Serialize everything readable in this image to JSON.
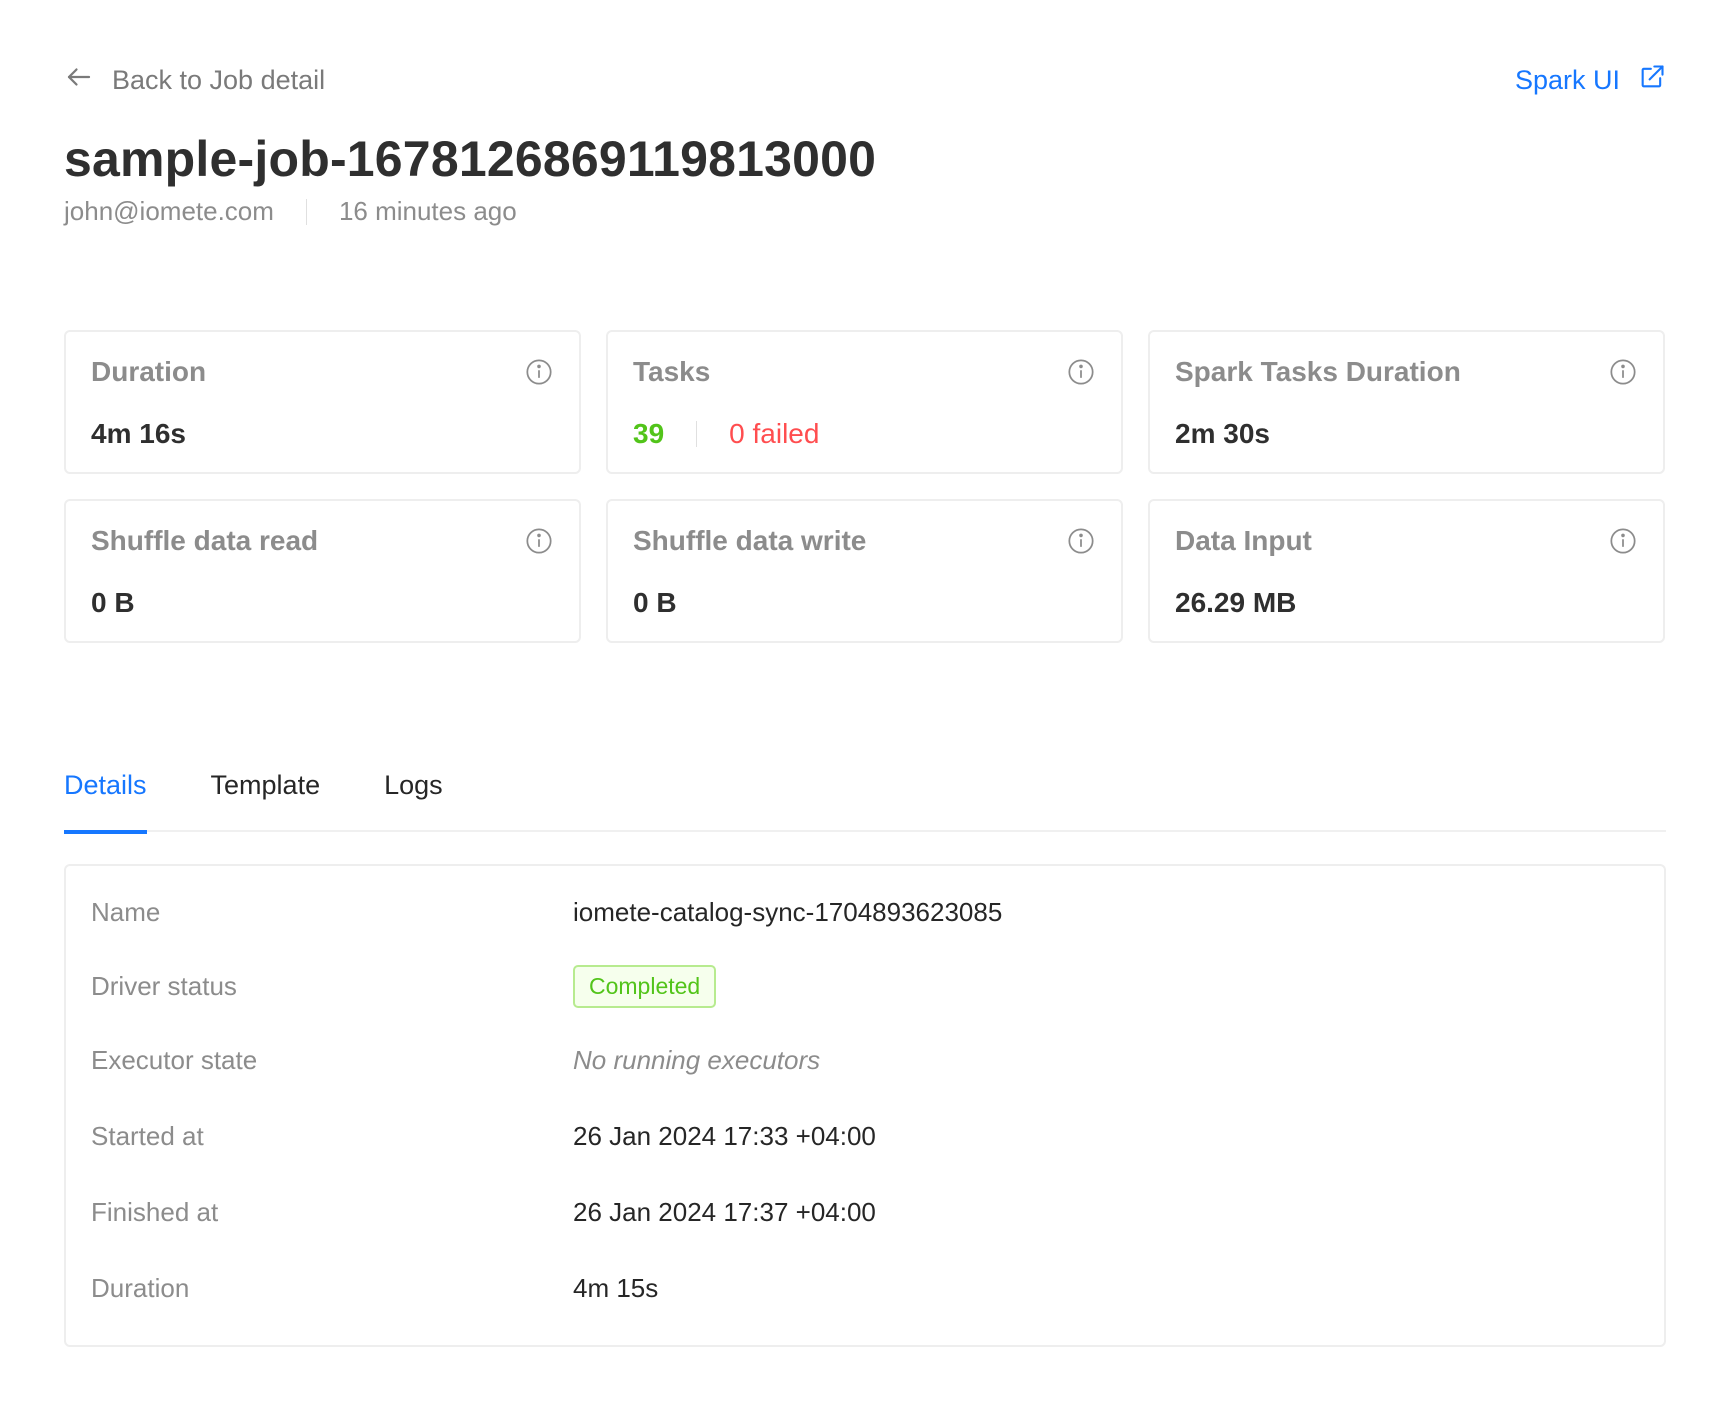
{
  "header": {
    "back_label": "Back to Job detail",
    "spark_ui_label": "Spark UI",
    "title": "sample-job-1678126869119813000",
    "user": "john@iomete.com",
    "time_ago": "16 minutes ago"
  },
  "stats": {
    "duration": {
      "label": "Duration",
      "value": "4m 16s"
    },
    "tasks": {
      "label": "Tasks",
      "count": "39",
      "failed": "0 failed"
    },
    "spark_tasks_duration": {
      "label": "Spark Tasks Duration",
      "value": "2m 30s"
    },
    "shuffle_read": {
      "label": "Shuffle data read",
      "value": "0 B"
    },
    "shuffle_write": {
      "label": "Shuffle data write",
      "value": "0 B"
    },
    "data_input": {
      "label": "Data Input",
      "value": "26.29 MB"
    }
  },
  "tabs": [
    {
      "label": "Details",
      "active": true
    },
    {
      "label": "Template",
      "active": false
    },
    {
      "label": "Logs",
      "active": false
    }
  ],
  "details": {
    "name": {
      "label": "Name",
      "value": "iomete-catalog-sync-1704893623085"
    },
    "driver_status": {
      "label": "Driver status",
      "value": "Completed"
    },
    "executor_state": {
      "label": "Executor state",
      "value": "No running executors"
    },
    "started_at": {
      "label": "Started at",
      "value": "26 Jan 2024 17:33 +04:00"
    },
    "finished_at": {
      "label": "Finished at",
      "value": "26 Jan 2024 17:37 +04:00"
    },
    "duration": {
      "label": "Duration",
      "value": "4m 15s"
    }
  },
  "colors": {
    "accent": "#1677ff",
    "success": "#52c41a",
    "danger": "#ff4d4f"
  }
}
